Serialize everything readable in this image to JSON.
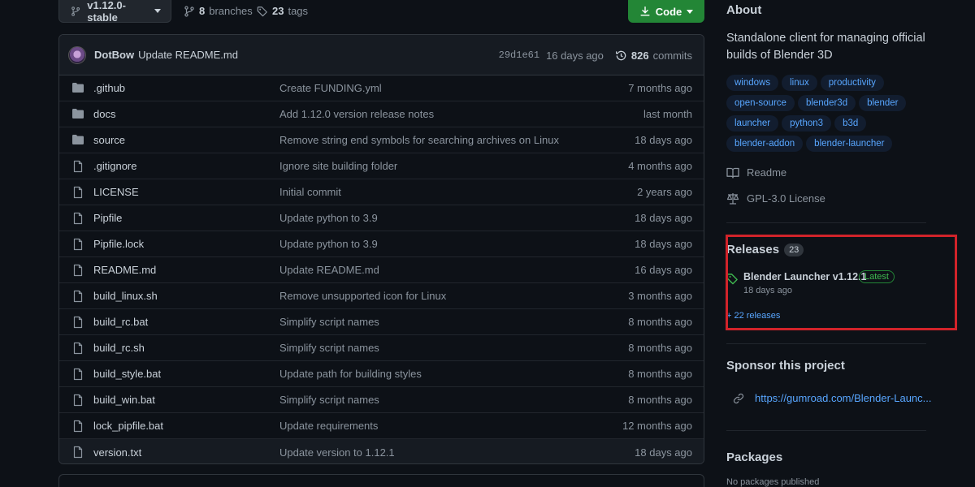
{
  "branch": {
    "name": "v1.12.0-stable"
  },
  "branches": {
    "count": "8",
    "label": "branches"
  },
  "tags": {
    "count": "23",
    "label": "tags"
  },
  "code_button": {
    "label": "Code"
  },
  "latest_commit": {
    "author": "DotBow",
    "message": "Update README.md",
    "sha": "29d1e61",
    "age": "16 days ago",
    "commit_count": "826",
    "commits_label": "commits"
  },
  "files": [
    {
      "type": "dir",
      "name": ".github",
      "message": "Create FUNDING.yml",
      "age": "7 months ago"
    },
    {
      "type": "dir",
      "name": "docs",
      "message": "Add 1.12.0 version release notes",
      "age": "last month"
    },
    {
      "type": "dir",
      "name": "source",
      "message": "Remove string end symbols for searching archives on Linux",
      "age": "18 days ago"
    },
    {
      "type": "file",
      "name": ".gitignore",
      "message": "Ignore site building folder",
      "age": "4 months ago"
    },
    {
      "type": "file",
      "name": "LICENSE",
      "message": "Initial commit",
      "age": "2 years ago"
    },
    {
      "type": "file",
      "name": "Pipfile",
      "message": "Update python to 3.9",
      "age": "18 days ago"
    },
    {
      "type": "file",
      "name": "Pipfile.lock",
      "message": "Update python to 3.9",
      "age": "18 days ago"
    },
    {
      "type": "file",
      "name": "README.md",
      "message": "Update README.md",
      "age": "16 days ago"
    },
    {
      "type": "file",
      "name": "build_linux.sh",
      "message": "Remove unsupported icon for Linux",
      "age": "3 months ago"
    },
    {
      "type": "file",
      "name": "build_rc.bat",
      "message": "Simplify script names",
      "age": "8 months ago"
    },
    {
      "type": "file",
      "name": "build_rc.sh",
      "message": "Simplify script names",
      "age": "8 months ago"
    },
    {
      "type": "file",
      "name": "build_style.bat",
      "message": "Update path for building styles",
      "age": "8 months ago"
    },
    {
      "type": "file",
      "name": "build_win.bat",
      "message": "Simplify script names",
      "age": "8 months ago"
    },
    {
      "type": "file",
      "name": "lock_pipfile.bat",
      "message": "Update requirements",
      "age": "12 months ago"
    },
    {
      "type": "file",
      "name": "version.txt",
      "message": "Update version to 1.12.1",
      "age": "18 days ago"
    }
  ],
  "about": {
    "heading": "About",
    "description": "Standalone client for managing official builds of Blender 3D",
    "topics": [
      "windows",
      "linux",
      "productivity",
      "open-source",
      "blender3d",
      "blender",
      "launcher",
      "python3",
      "b3d",
      "blender-addon",
      "blender-launcher"
    ],
    "readme_label": "Readme",
    "license_label": "GPL-3.0 License"
  },
  "releases": {
    "heading": "Releases",
    "count": "23",
    "latest_name": "Blender Launcher v1.12.1",
    "latest_badge": "Latest",
    "latest_date": "18 days ago",
    "more_label": "+ 22 releases"
  },
  "sponsor": {
    "heading": "Sponsor this project",
    "link": "https://gumroad.com/Blender-Launc..."
  },
  "packages": {
    "heading": "Packages",
    "empty_label": "No packages published"
  },
  "colors": {
    "accent": "#58a6ff",
    "green": "#238636",
    "highlight": "#d1232a",
    "bg": "#0d1117"
  }
}
